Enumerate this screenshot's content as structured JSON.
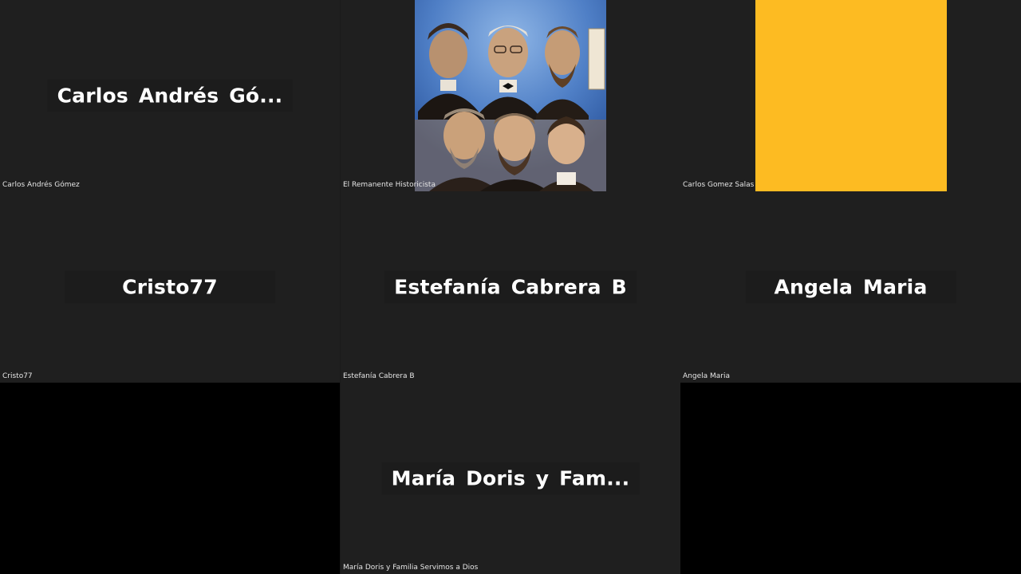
{
  "tiles": [
    {
      "id": "t1",
      "big_name": "Carlos Andrés Gó...",
      "label": "Carlos Andrés Gómez"
    },
    {
      "id": "t2",
      "label": "El Remanente Historicista"
    },
    {
      "id": "t3",
      "label": "Carlos Gomez Salas",
      "video_color": "#fdbb22"
    },
    {
      "id": "t4",
      "big_name": "Cristo77",
      "label": "Cristo77"
    },
    {
      "id": "t5",
      "big_name": "Estefanía Cabrera B",
      "label": "Estefanía Cabrera B"
    },
    {
      "id": "t6",
      "big_name": "Angela Maria",
      "label": "Angela Maria"
    },
    {
      "id": "t8",
      "big_name": "María Doris y Fam...",
      "label": "María Doris y Familia Servimos a Dios"
    }
  ]
}
